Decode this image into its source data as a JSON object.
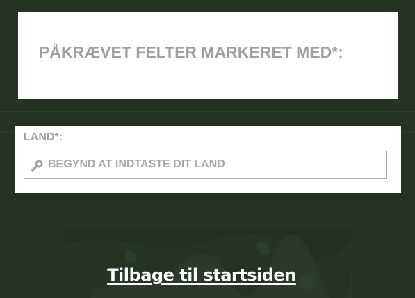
{
  "required_notice": {
    "text": "PÅKRÆVET FELTER MARKERET MED*:"
  },
  "country_field": {
    "label": "LAND*:",
    "placeholder": "BEGYND AT INDTASTE DIT LAND",
    "value": "",
    "icon": "search-icon"
  },
  "footer": {
    "back_link": "Tilbage til startsiden",
    "background_image": "map-texture"
  },
  "colors": {
    "page_background": "#243322",
    "panel_background": "#ffffff",
    "muted_text": "#a0a0a0",
    "link_text": "#ffffff"
  }
}
